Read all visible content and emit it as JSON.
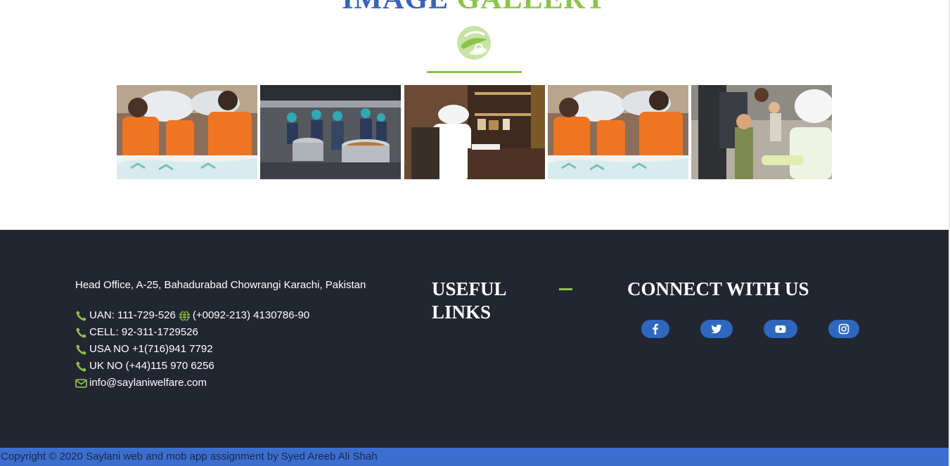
{
  "gallery": {
    "title_word1": "IMAGE",
    "title_word2": "GALLERY",
    "images": [
      {
        "alt": "volunteers-carrying-flour-sacks"
      },
      {
        "alt": "staff-cooking-in-kitchen"
      },
      {
        "alt": "cleric-at-desk"
      },
      {
        "alt": "volunteers-carrying-flour-sacks"
      },
      {
        "alt": "cleric-with-children"
      }
    ]
  },
  "footer": {
    "address": "Head Office, A-25, Bahadurabad Chowrangi Karachi, Pakistan",
    "uan": "UAN: 111-729-526",
    "uan_alt": "(+0092-213) 4130786-90",
    "cell": "CELL: 92-311-1729526",
    "usa": "USA NO +1(716)941 7792",
    "uk": "UK NO (+44)115 970 6256",
    "email": "info@saylaniwelfare.com",
    "useful_links_title": "USEFUL LINKS",
    "connect_title": "CONNECT WITH US",
    "social": [
      {
        "icon": "facebook-icon"
      },
      {
        "icon": "twitter-icon"
      },
      {
        "icon": "youtube-icon"
      },
      {
        "icon": "instagram-icon"
      }
    ]
  },
  "copyright": "Copyright © 2020 Saylani web and mob app assignment by Syed Areeb Ali Shah",
  "colors": {
    "brand_blue": "#3a63b8",
    "brand_green": "#8dc34a",
    "footer_bg": "#222631",
    "social_bg": "#2e67be",
    "copyright_bg": "#3a6fd0"
  }
}
